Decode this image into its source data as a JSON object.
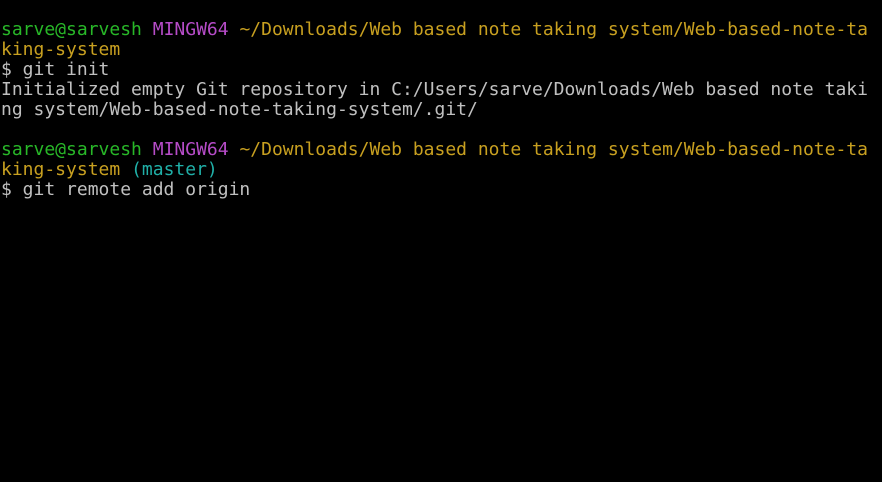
{
  "terminal": {
    "lines": [
      {
        "user": "sarve@sarvesh",
        "host": "MINGW64",
        "path": "~/Downloads/Web based note taking system/Web-based-note-ta"
      },
      {
        "path": "king-system"
      },
      {
        "text": "$ git init"
      },
      {
        "text": "Initialized empty Git repository in C:/Users/sarve/Downloads/Web based note taki"
      },
      {
        "text": "ng system/Web-based-note-taking-system/.git/"
      },
      {
        "text": ""
      },
      {
        "user": "sarve@sarvesh",
        "host": "MINGW64",
        "path": "~/Downloads/Web based note taking system/Web-based-note-ta"
      },
      {
        "path": "king-system",
        "branch": "(master)"
      },
      {
        "text": "$ git remote add origin"
      }
    ]
  },
  "colors": {
    "background": "#000000",
    "user": "#28b828",
    "host": "#b64cc8",
    "path": "#c8a020",
    "branch": "#20b0a8",
    "text": "#c0c0c0"
  }
}
